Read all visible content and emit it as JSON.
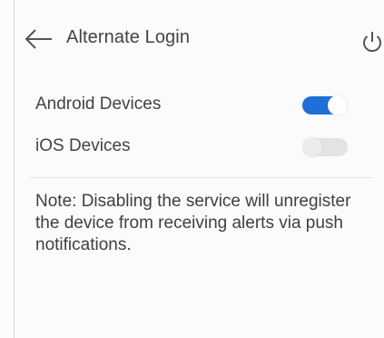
{
  "header": {
    "title": "Alternate Login",
    "back_icon": "arrow-left-icon",
    "power_icon": "power-icon"
  },
  "settings": [
    {
      "label": "Android Devices",
      "enabled": true
    },
    {
      "label": "iOS Devices",
      "enabled": false
    }
  ],
  "note": "Note: Disabling the service will unregister the device from receiving alerts via push notifications.",
  "colors": {
    "toggle_on": "#1e6fd6",
    "toggle_off": "#e3e3e3",
    "text": "#3b3b3b"
  }
}
